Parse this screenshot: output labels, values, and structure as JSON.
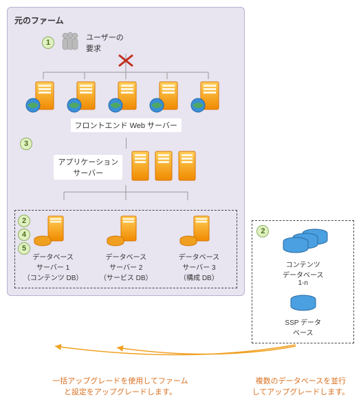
{
  "farm": {
    "title": "元のファーム",
    "step1": "1",
    "users_label": "ユーザーの\n要求",
    "fe_label": "フロントエンド Web サーバー",
    "step3": "3",
    "app_label": "アプリケーション\nサーバー",
    "db_steps": [
      "2",
      "4",
      "5"
    ],
    "db_servers": [
      {
        "name": "データベース\nサーバー 1",
        "sub": "（コンテンツ DB）"
      },
      {
        "name": "データベース\nサーバー 2",
        "sub": "（サービス DB）"
      },
      {
        "name": "データベース\nサーバー 3",
        "sub": "（構成 DB）"
      }
    ]
  },
  "right": {
    "step": "2",
    "content_db": "コンテンツ\nデータベース\n1-n",
    "ssp_db": "SSP データ\nベース"
  },
  "captions": {
    "left": "一括アップグレードを使用してファーム\nと設定をアップグレードします。",
    "right": "複数のデータベースを並行\nしてアップグレードします。"
  }
}
